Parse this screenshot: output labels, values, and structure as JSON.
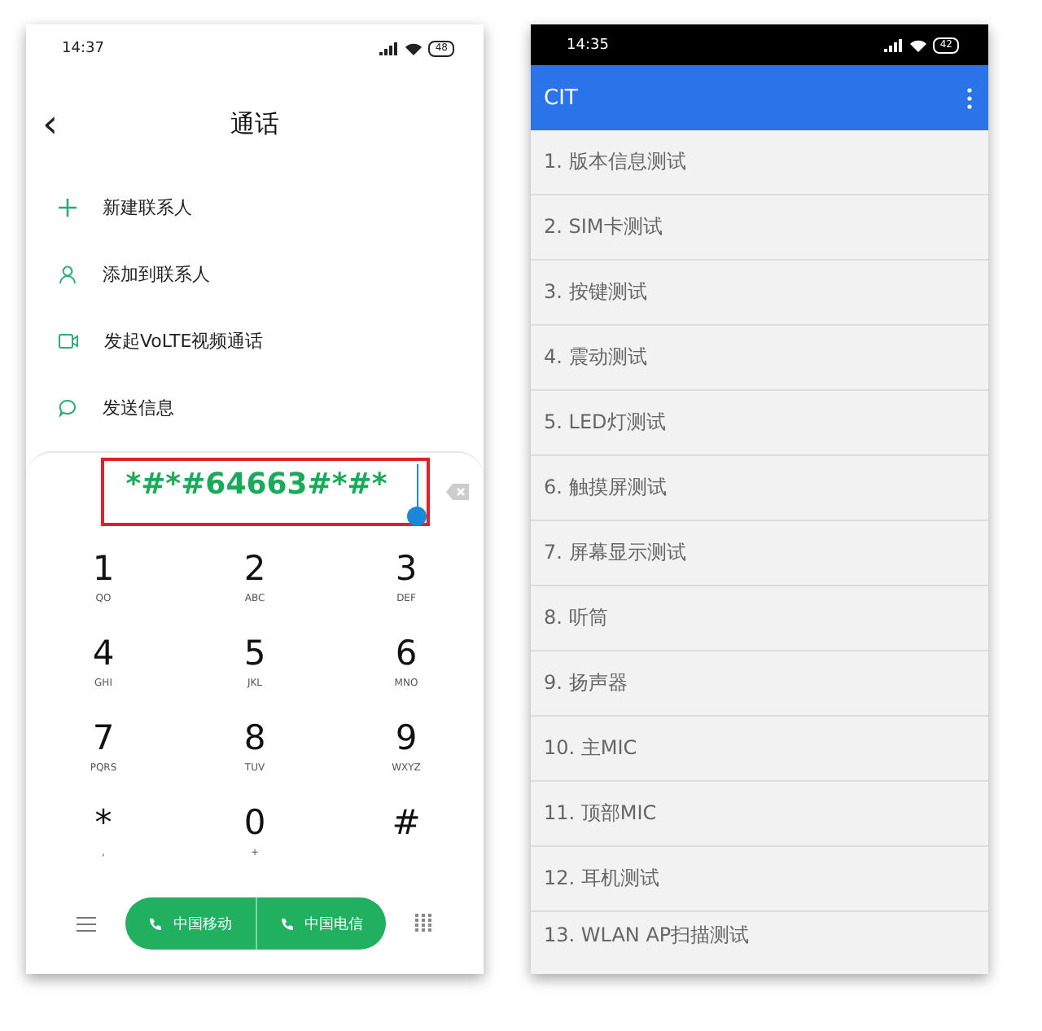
{
  "left_phone": {
    "status_bar": {
      "time": "14:37",
      "battery": "48"
    },
    "header": {
      "back": "‹",
      "title": "通话"
    },
    "actions": [
      {
        "kind": "add",
        "label": "新建联系人"
      },
      {
        "kind": "person",
        "label": "添加到联系人"
      },
      {
        "kind": "video",
        "label": "发起VoLTE视频通话"
      },
      {
        "kind": "message",
        "label": "发送信息"
      }
    ],
    "dialer": {
      "number": "*#*#64663#*#*",
      "highlighted": true,
      "keys": [
        {
          "digit": "1",
          "letters": "QO"
        },
        {
          "digit": "2",
          "letters": "ABC"
        },
        {
          "digit": "3",
          "letters": "DEF"
        },
        {
          "digit": "4",
          "letters": "GHI"
        },
        {
          "digit": "5",
          "letters": "JKL"
        },
        {
          "digit": "6",
          "letters": "MNO"
        },
        {
          "digit": "7",
          "letters": "PQRS"
        },
        {
          "digit": "8",
          "letters": "TUV"
        },
        {
          "digit": "9",
          "letters": "WXYZ"
        },
        {
          "digit": "*",
          "letters": ","
        },
        {
          "digit": "0",
          "letters": "+"
        },
        {
          "digit": "#"
        }
      ],
      "call_buttons": [
        {
          "label": "中国移动"
        },
        {
          "label": "中国电信"
        }
      ]
    }
  },
  "right_phone": {
    "status_bar": {
      "time": "14:35",
      "battery": "42"
    },
    "app_bar": {
      "title": "CIT"
    },
    "items": [
      "1. 版本信息测试",
      "2. SIM卡测试",
      "3. 按键测试",
      "4. 震动测试",
      "5. LED灯测试",
      "6. 触摸屏测试",
      "7. 屏幕显示测试",
      "8. 听筒",
      "9. 扬声器",
      "10. 主MIC",
      "11. 顶部MIC",
      "12. 耳机测试",
      "13. WLAN AP扫描测试"
    ]
  }
}
